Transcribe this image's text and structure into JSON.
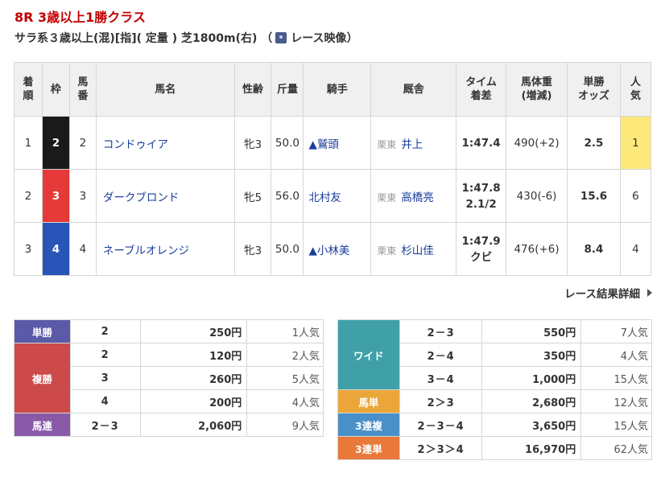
{
  "race": {
    "title": "8R 3歳以上1勝クラス",
    "condition": "サラ系３歳以上(混)[指](  定量  ) 芝1800m(右)  （",
    "video_label": "レース映像",
    "close_paren": " ）"
  },
  "result_table": {
    "headers": {
      "rank": [
        "着",
        "順"
      ],
      "waku": "枠",
      "umaban": [
        "馬",
        "番"
      ],
      "name": "馬名",
      "sexage": "性齢",
      "weight": "斤量",
      "jockey": "騎手",
      "stable": "厩舎",
      "time": [
        "タイム",
        "着差"
      ],
      "body": [
        "馬体重",
        "(増減)"
      ],
      "odds": [
        "単勝",
        "オッズ"
      ],
      "popularity": [
        "人",
        "気"
      ]
    },
    "rows": [
      {
        "rank": "1",
        "waku": "2",
        "umaban": "2",
        "name": "コンドゥイア",
        "sexage": "牝3",
        "weight": "50.0",
        "jockey": "▲鷲頭",
        "region": "栗東",
        "trainer": "井上",
        "time": "1:47.4",
        "margin": "",
        "body": "490(+2)",
        "odds": "2.5",
        "popularity": "1"
      },
      {
        "rank": "2",
        "waku": "3",
        "umaban": "3",
        "name": "ダークブロンド",
        "sexage": "牝5",
        "weight": "56.0",
        "jockey": "北村友",
        "region": "栗東",
        "trainer": "高橋亮",
        "time": "1:47.8",
        "margin": "2.1/2",
        "body": "430(-6)",
        "odds": "15.6",
        "popularity": "6"
      },
      {
        "rank": "3",
        "waku": "4",
        "umaban": "4",
        "name": "ネーブルオレンジ",
        "sexage": "牝3",
        "weight": "50.0",
        "jockey": "▲小林美",
        "region": "栗東",
        "trainer": "杉山佳",
        "time": "1:47.9",
        "margin": "クビ",
        "body": "476(+6)",
        "odds": "8.4",
        "popularity": "4"
      }
    ]
  },
  "detail_link": "レース結果詳細",
  "payout_left": {
    "tansho": {
      "label": "単勝",
      "combo": "2",
      "amount": "250円",
      "pop": "1人気"
    },
    "fukusho": {
      "label": "複勝",
      "rows": [
        {
          "combo": "2",
          "amount": "120円",
          "pop": "2人気"
        },
        {
          "combo": "3",
          "amount": "260円",
          "pop": "5人気"
        },
        {
          "combo": "4",
          "amount": "200円",
          "pop": "4人気"
        }
      ]
    },
    "umaren": {
      "label": "馬連",
      "combo": "2－3",
      "amount": "2,060円",
      "pop": "9人気"
    }
  },
  "payout_right": {
    "wide": {
      "label": "ワイド",
      "rows": [
        {
          "combo": "2－3",
          "amount": "550円",
          "pop": "7人気"
        },
        {
          "combo": "2－4",
          "amount": "350円",
          "pop": "4人気"
        },
        {
          "combo": "3－4",
          "amount": "1,000円",
          "pop": "15人気"
        }
      ]
    },
    "umatan": {
      "label": "馬単",
      "combo": "2＞3",
      "amount": "2,680円",
      "pop": "12人気"
    },
    "sanrenpuku": {
      "label": "3連複",
      "combo": "2－3－4",
      "amount": "3,650円",
      "pop": "15人気"
    },
    "sanrentan": {
      "label": "3連単",
      "combo": "2＞3＞4",
      "amount": "16,970円",
      "pop": "62人気"
    }
  }
}
